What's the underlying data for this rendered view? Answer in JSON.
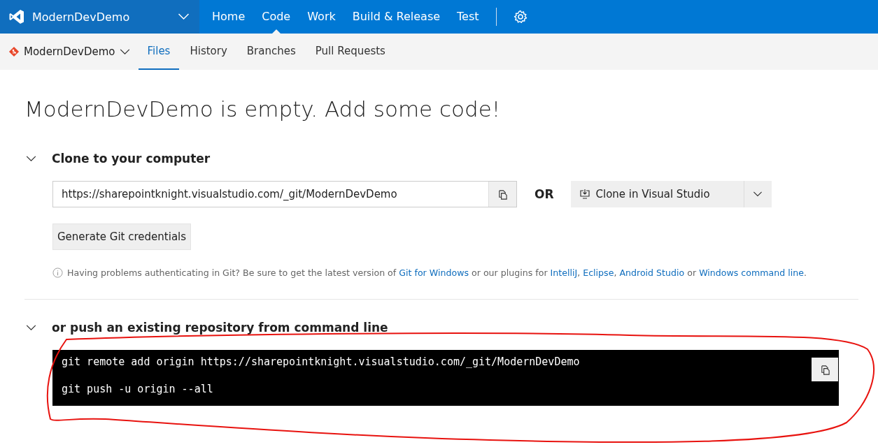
{
  "top_nav": {
    "project": "ModernDevDemo",
    "items": [
      {
        "label": "Home",
        "selected": false
      },
      {
        "label": "Code",
        "selected": true
      },
      {
        "label": "Work",
        "selected": false
      },
      {
        "label": "Build & Release",
        "selected": false
      },
      {
        "label": "Test",
        "selected": false
      }
    ]
  },
  "sub_nav": {
    "repo": "ModernDevDemo",
    "tabs": [
      {
        "label": "Files",
        "selected": true
      },
      {
        "label": "History",
        "selected": false
      },
      {
        "label": "Branches",
        "selected": false
      },
      {
        "label": "Pull Requests",
        "selected": false
      }
    ]
  },
  "heading": "ModernDevDemo is empty. Add some code!",
  "clone_section": {
    "title": "Clone to your computer",
    "expanded": true,
    "url": "https://sharepointknight.visualstudio.com/_git/ModernDevDemo",
    "or_label": "OR",
    "clone_button": "Clone in Visual Studio",
    "credentials_button": "Generate Git credentials",
    "help": [
      {
        "text": "Having problems authenticating in Git? Be sure to get the latest version of ",
        "link": false
      },
      {
        "text": "Git for Windows",
        "link": true
      },
      {
        "text": " or our plugins for ",
        "link": false
      },
      {
        "text": "IntelliJ",
        "link": true
      },
      {
        "text": ", ",
        "link": false
      },
      {
        "text": "Eclipse",
        "link": true
      },
      {
        "text": ", ",
        "link": false
      },
      {
        "text": "Android Studio",
        "link": true
      },
      {
        "text": " or ",
        "link": false
      },
      {
        "text": "Windows command line",
        "link": true
      },
      {
        "text": ".",
        "link": false
      }
    ]
  },
  "push_section": {
    "title": "or push an existing repository from command line",
    "expanded": true,
    "commands": [
      "git remote add origin https://sharepointknight.visualstudio.com/_git/ModernDevDemo",
      "git push -u origin --all"
    ]
  }
}
